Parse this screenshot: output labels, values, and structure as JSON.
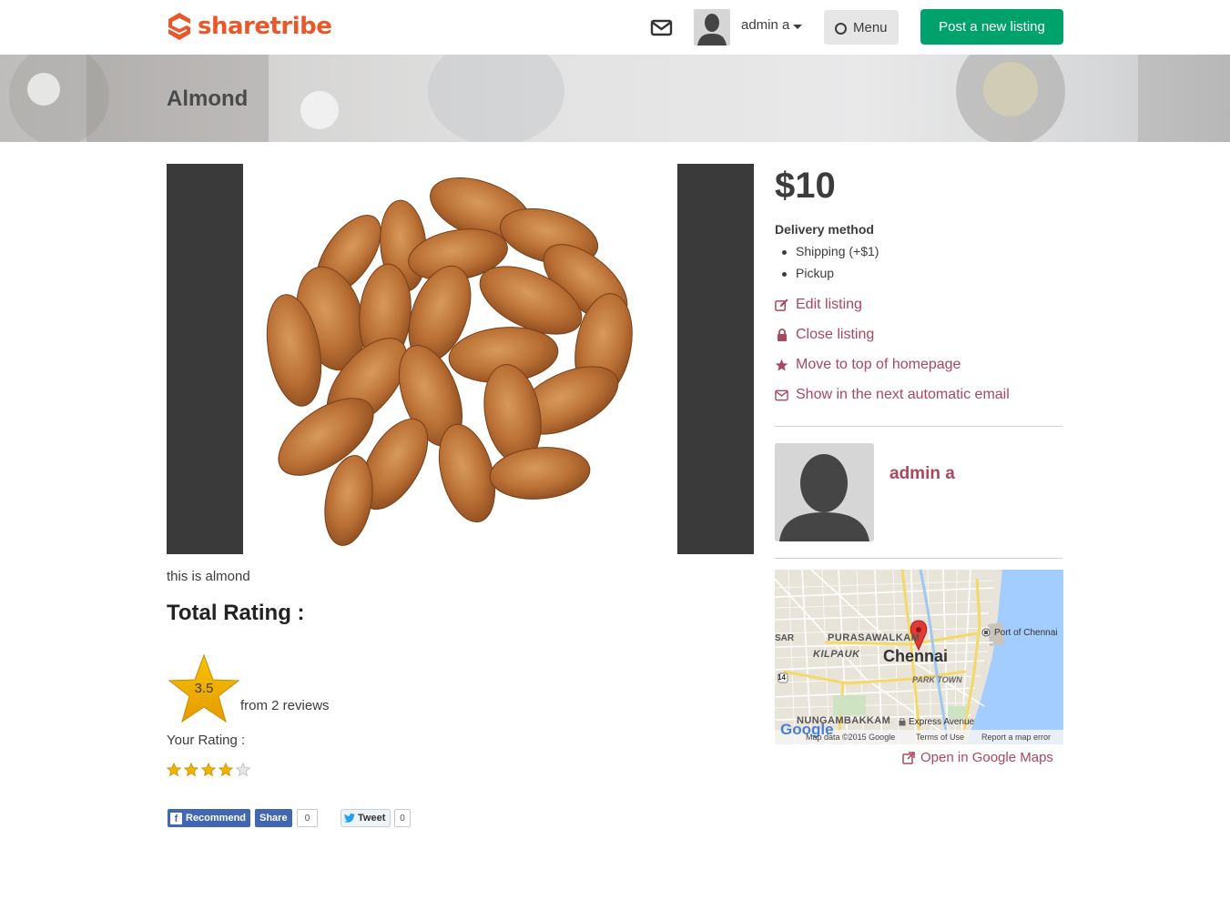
{
  "header": {
    "logo_text": "sharetribe",
    "user_name": "admin a",
    "menu_label": "Menu",
    "post_button": "Post a new listing"
  },
  "listing": {
    "title": "Almond",
    "description": "this is almond",
    "price": "$10",
    "delivery_label": "Delivery method",
    "delivery_options": [
      "Shipping (+$1)",
      "Pickup"
    ]
  },
  "rating": {
    "title": "Total Rating :",
    "score": "3.5",
    "reviews_text": "from 2 reviews",
    "your_rating_label": "Your Rating :",
    "your_rating_value": 4,
    "your_rating_max": 5
  },
  "social": {
    "recommend": "Recommend",
    "share": "Share",
    "fb_count": "0",
    "tweet": "Tweet",
    "tweet_count": "0"
  },
  "actions": {
    "edit": "Edit listing",
    "close": "Close listing",
    "move_top": "Move to top of homepage",
    "email": "Show in the next automatic email"
  },
  "author": {
    "name": "admin a"
  },
  "map": {
    "labels": {
      "purasawalkam": "PURASAWALKAM",
      "kilpauk": "KILPAUK",
      "chennai": "Chennai",
      "park_town": "PARK TOWN",
      "port": "Port of Chennai",
      "nungambakkam": "NUNGAMBAKKAM",
      "express": "Express Avenue",
      "sar": "SAR",
      "road_14": "14",
      "google": "Google",
      "map_data": "Map data ©2015 Google",
      "terms": "Terms of Use",
      "report": "Report a map error"
    },
    "open_link": "Open in Google Maps"
  },
  "colors": {
    "brand_orange": "#e8582a",
    "post_green": "#00a26c",
    "link_maroon": "#a8485f",
    "facebook_blue": "#4267b2",
    "star_gold": "#f0b400"
  }
}
